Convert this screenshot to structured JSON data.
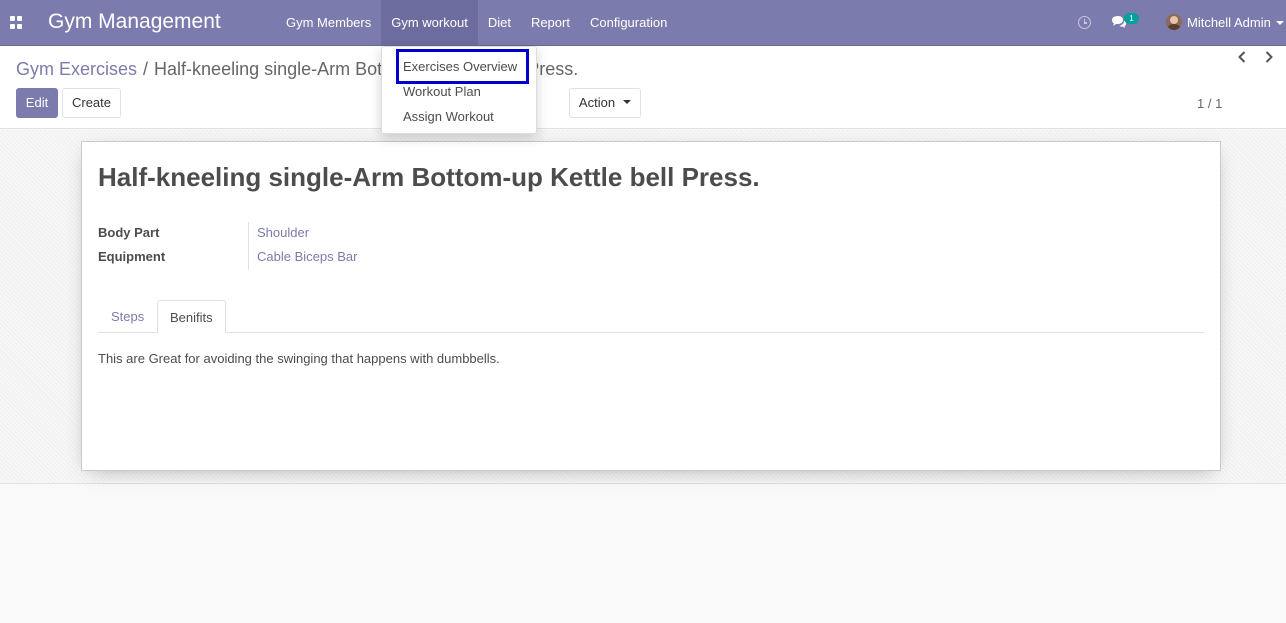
{
  "navbar": {
    "brand": "Gym Management",
    "menu": [
      "Gym Members",
      "Gym workout",
      "Diet",
      "Report",
      "Configuration"
    ],
    "notification_count": "1",
    "user_name": "Mitchell Admin"
  },
  "dropdown": {
    "items": [
      "Exercises Overview",
      "Workout Plan",
      "Assign Workout"
    ]
  },
  "breadcrumb": {
    "parent": "Gym Exercises",
    "separator": "/",
    "current": "Half-kneeling single-Arm Bottom-up Kettle bell Press."
  },
  "buttons": {
    "edit": "Edit",
    "create": "Create",
    "action": "Action"
  },
  "pager": {
    "value": "1 / 1"
  },
  "record": {
    "title": "Half-kneeling single-Arm Bottom-up Kettle bell Press.",
    "fields": [
      {
        "label": "Body Part",
        "value": "Shoulder"
      },
      {
        "label": "Equipment",
        "value": "Cable Biceps Bar"
      }
    ],
    "tabs": [
      "Steps",
      "Benifits"
    ],
    "active_tab_content": "This are Great for avoiding the swinging that happens with dumbbells."
  },
  "colors": {
    "navbar": "#7c7bad",
    "highlight_border": "#0000cc",
    "badge": "#00a09d"
  }
}
